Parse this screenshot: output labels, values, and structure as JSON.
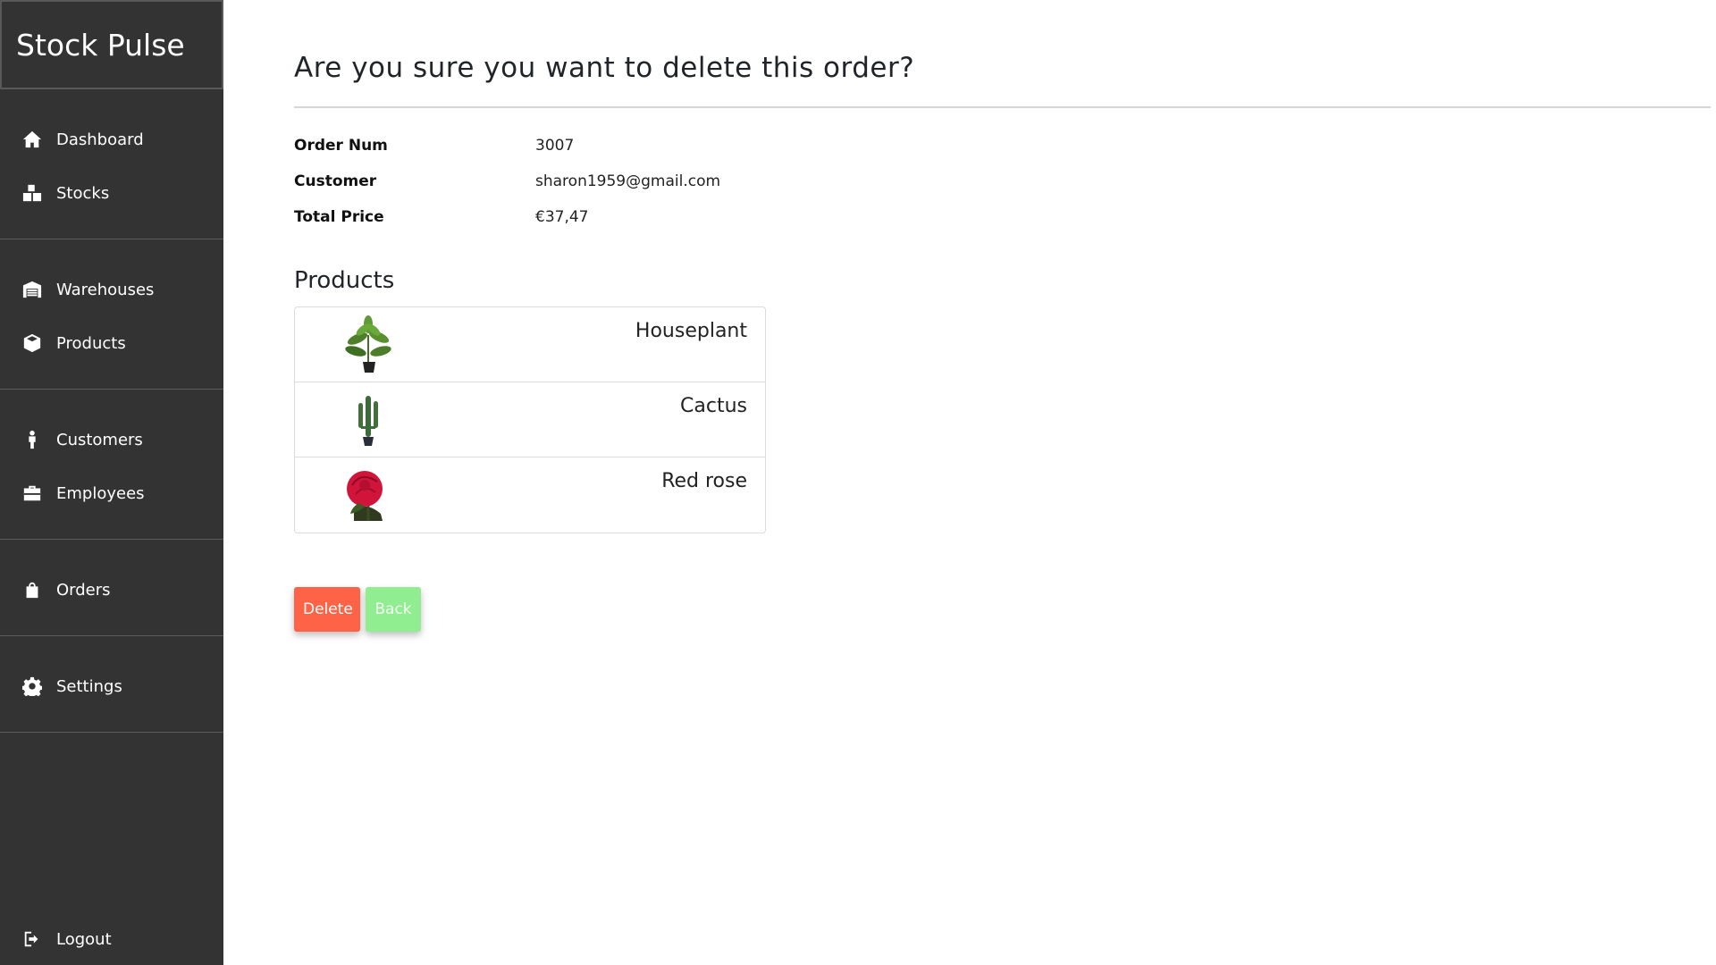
{
  "brand": "Stock Pulse",
  "sidebar": {
    "groups": [
      [
        {
          "label": "Dashboard",
          "icon": "home-icon"
        },
        {
          "label": "Stocks",
          "icon": "boxes-icon"
        }
      ],
      [
        {
          "label": "Warehouses",
          "icon": "warehouse-icon"
        },
        {
          "label": "Products",
          "icon": "box-icon"
        }
      ],
      [
        {
          "label": "Customers",
          "icon": "person-icon"
        },
        {
          "label": "Employees",
          "icon": "briefcase-icon"
        }
      ],
      [
        {
          "label": "Orders",
          "icon": "shopping-bag-icon"
        }
      ],
      [
        {
          "label": "Settings",
          "icon": "gear-icon"
        }
      ]
    ],
    "logout": {
      "label": "Logout",
      "icon": "logout-icon"
    }
  },
  "page": {
    "heading": "Are you sure you want to delete this order?",
    "details": [
      {
        "label": "Order Num",
        "value": "3007"
      },
      {
        "label": "Customer",
        "value": "sharon1959@gmail.com"
      },
      {
        "label": "Total Price",
        "value": "€37,47"
      }
    ],
    "products_title": "Products",
    "products": [
      {
        "name": "Houseplant",
        "image": "houseplant"
      },
      {
        "name": "Cactus",
        "image": "cactus"
      },
      {
        "name": "Red rose",
        "image": "red-rose"
      }
    ],
    "actions": {
      "delete_label": "Delete",
      "back_label": "Back"
    }
  },
  "colors": {
    "sidebar_bg": "#333333",
    "delete": "#ff6347",
    "back": "#90ee90"
  }
}
